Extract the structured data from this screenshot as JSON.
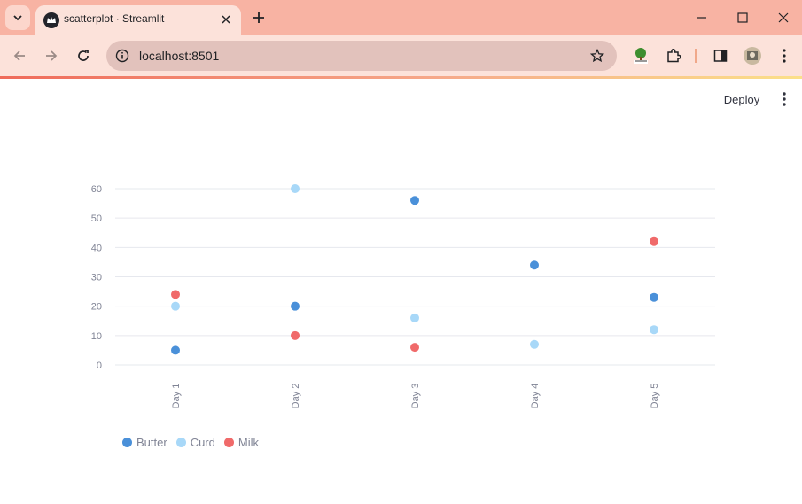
{
  "browser": {
    "tab_title": "scatterplot · Streamlit",
    "url": "localhost:8501"
  },
  "app": {
    "deploy_label": "Deploy"
  },
  "icons": [
    "chevron-down-icon",
    "streamlit-crown-icon",
    "close-icon",
    "plus-icon",
    "minimize-icon",
    "maximize-icon",
    "close-window-icon",
    "back-arrow-icon",
    "forward-arrow-icon",
    "reload-icon",
    "info-icon",
    "star-icon",
    "tree-extension-icon",
    "puzzle-icon",
    "sidebar-icon",
    "avatar",
    "kebab-menu-icon"
  ],
  "colors": {
    "butter": "#4a90d9",
    "curd": "#a8d8f8",
    "milk": "#f06a6a",
    "tabbar": "#f8b3a3",
    "toolbar": "#fce2da"
  },
  "chart_data": {
    "type": "scatter",
    "categories": [
      "Day 1",
      "Day 2",
      "Day 3",
      "Day 4",
      "Day 5"
    ],
    "series": [
      {
        "name": "Butter",
        "color": "#4a90d9",
        "values": [
          5,
          20,
          56,
          34,
          23
        ]
      },
      {
        "name": "Curd",
        "color": "#a8d8f8",
        "values": [
          20,
          60,
          16,
          7,
          12
        ]
      },
      {
        "name": "Milk",
        "color": "#f06a6a",
        "values": [
          24,
          10,
          6,
          null,
          42
        ]
      }
    ],
    "yticks": [
      "0",
      "10",
      "20",
      "30",
      "40",
      "50",
      "60"
    ],
    "ylim": [
      0,
      60
    ],
    "grid": true,
    "legend_position": "bottom-left"
  }
}
